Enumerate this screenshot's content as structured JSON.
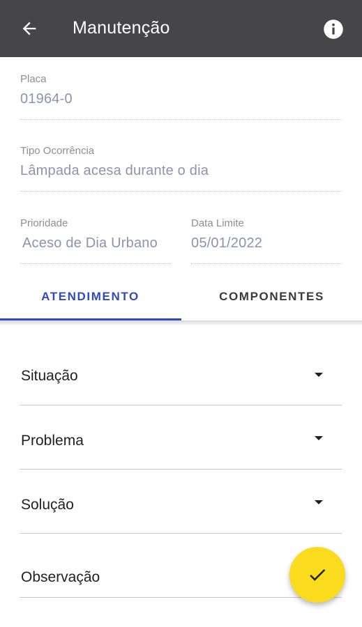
{
  "appbar": {
    "title": "Manutenção",
    "back_icon": "arrow-left-icon",
    "info_icon": "info-icon"
  },
  "fields": {
    "placa": {
      "label": "Placa",
      "value": "01964-0"
    },
    "tipo_ocorrencia": {
      "label": "Tipo Ocorrência",
      "value": "Lâmpada acesa durante o dia"
    },
    "prioridade": {
      "label": "Prioridade",
      "value": "Aceso de Dia Urbano"
    },
    "data_limite": {
      "label": "Data Limite",
      "value": "05/01/2022"
    }
  },
  "tabs": [
    {
      "label": "ATENDIMENTO",
      "active": true
    },
    {
      "label": "COMPONENTES",
      "active": false
    }
  ],
  "form": {
    "situacao": {
      "label": "Situação"
    },
    "problema": {
      "label": "Problema"
    },
    "solucao": {
      "label": "Solução"
    },
    "observacao": {
      "label": "Observação"
    }
  },
  "fab": {
    "icon": "check-icon",
    "color": "#fadb1e"
  },
  "colors": {
    "appbar": "#464548",
    "accent": "#2f4bb8"
  }
}
